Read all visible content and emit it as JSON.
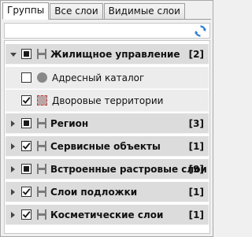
{
  "tabs": [
    {
      "label": "Группы",
      "active": true
    },
    {
      "label": "Все слои",
      "active": false
    },
    {
      "label": "Видимые слои",
      "active": false
    }
  ],
  "toolbar": {
    "refresh_icon": "refresh-icon"
  },
  "tree": {
    "items": [
      {
        "label": "Жилищное управление",
        "count": "[2]",
        "expanded": true,
        "checkbox": "partial",
        "bold": true
      },
      {
        "label": "Адресный каталог",
        "child": true,
        "checkbox": "unchecked",
        "icon": "circle-icon"
      },
      {
        "label": "Дворовые территории",
        "child": true,
        "checkbox": "checked",
        "icon": "polygon-icon"
      },
      {
        "label": "Регион",
        "count": "[3]",
        "expanded": false,
        "checkbox": "partial",
        "bold": true
      },
      {
        "label": "Сервисные объекты",
        "count": "[1]",
        "expanded": false,
        "checkbox": "checked",
        "bold": true
      },
      {
        "label": "Встроенные растровые слои",
        "count": "[9]",
        "expanded": false,
        "checkbox": "partial",
        "bold": true
      },
      {
        "label": "Слои подложки",
        "count": "[1]",
        "expanded": false,
        "checkbox": "checked",
        "bold": true
      },
      {
        "label": "Косметические слои",
        "count": "[1]",
        "expanded": false,
        "checkbox": "checked",
        "bold": true
      }
    ]
  }
}
